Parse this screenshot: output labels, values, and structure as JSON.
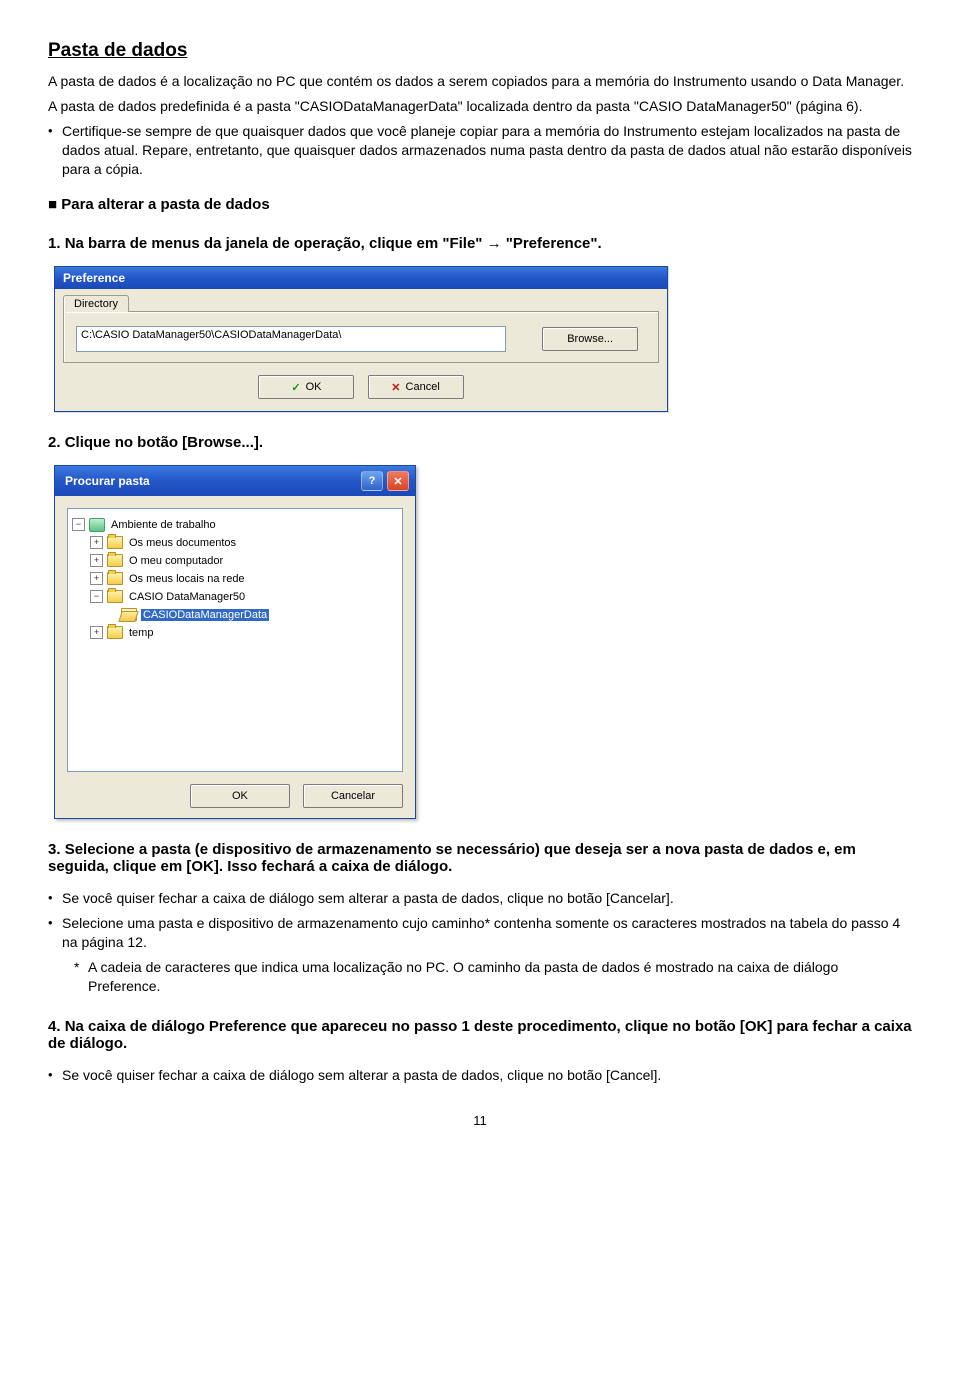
{
  "title": "Pasta de dados",
  "para1": "A pasta de dados é a localização no PC que contém os dados a serem copiados para a memória do Instrumento usando o Data Manager.",
  "para2": "A pasta de dados predefinida é a pasta \"CASIODataManagerData\" localizada dentro da pasta \"CASIO DataManager50\" (página 6).",
  "bullet1": "Certifique-se sempre de que quaisquer dados que você planeje copiar para a memória do Instrumento estejam localizados na pasta de dados atual. Repare, entretanto, que quaisquer dados armazenados numa pasta dentro da pasta de dados atual não estarão disponíveis para a cópia.",
  "section_heading": "Para alterar a pasta de dados",
  "step1_num": "1.",
  "step1_txt": "Na barra de menus da janela de operação, clique em \"File\" → \"Preference\".",
  "preference": {
    "title": "Preference",
    "tab": "Directory",
    "path": "C:\\CASIO DataManager50\\CASIODataManagerData\\",
    "browse": "Browse...",
    "ok": "OK",
    "cancel": "Cancel"
  },
  "step2_num": "2.",
  "step2_txt": "Clique no botão [Browse...].",
  "browse_dialog": {
    "title": "Procurar pasta",
    "root": "Ambiente de trabalho",
    "n1": "Os meus documentos",
    "n2": "O meu computador",
    "n3": "Os meus locais na rede",
    "n4": "CASIO DataManager50",
    "n4a": "CASIODataManagerData",
    "n5": "temp",
    "ok": "OK",
    "cancel": "Cancelar"
  },
  "step3_num": "3.",
  "step3_txt": "Selecione a pasta (e dispositivo de armazenamento se necessário) que deseja ser a nova pasta de dados e, em seguida, clique em [OK]. Isso fechará a caixa de diálogo.",
  "bullet3a": "Se você quiser fechar a caixa de diálogo sem alterar a pasta de dados, clique no botão [Cancelar].",
  "bullet3b": "Selecione uma pasta e dispositivo de armazenamento cujo caminho* contenha somente os caracteres mostrados na tabela do passo 4 na página 12.",
  "footnote": "A cadeia de caracteres que indica uma localização no PC. O caminho da pasta de dados é mostrado na caixa de diálogo Preference.",
  "step4_num": "4.",
  "step4_txt": "Na caixa de diálogo Preference que apareceu no passo 1 deste procedimento, clique no botão [OK] para fechar a caixa de diálogo.",
  "bullet4": "Se você quiser fechar a caixa de diálogo sem alterar a pasta de dados, clique no botão [Cancel].",
  "page_number": "11"
}
